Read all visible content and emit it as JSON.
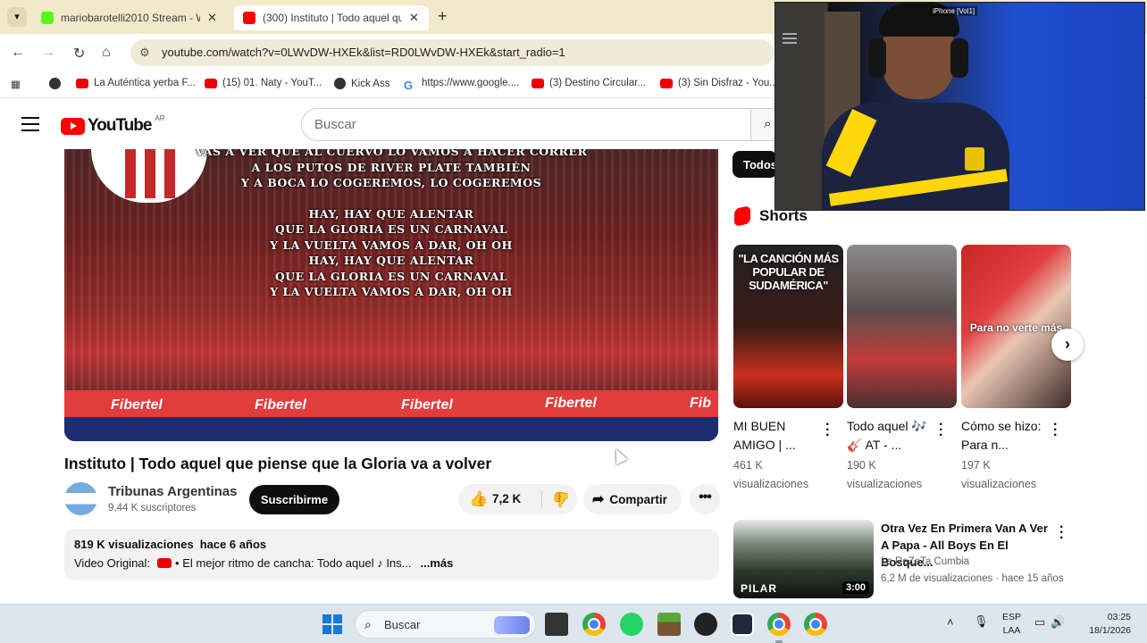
{
  "browser": {
    "tabs": [
      {
        "title": "mariobarotelli2010 Stream - W",
        "favicon": "kick-icon",
        "color": "#53fc18"
      },
      {
        "title": "(300) Instituto | Todo aquel que",
        "favicon": "youtube-icon",
        "color": "#ff0000",
        "active": true
      }
    ],
    "url": "youtube.com/watch?v=0LWvDW-HXEk&list=RD0LWvDW-HXEk&start_radio=1",
    "bookmarks": [
      {
        "label": "La Auténtica yerba F...",
        "icon": "youtube-icon"
      },
      {
        "label": "(15) 01. Naty - YouT...",
        "icon": "youtube-icon"
      },
      {
        "label": "Kick Ass",
        "icon": "globe-icon"
      },
      {
        "label": "https://www.google....",
        "icon": "google-icon"
      },
      {
        "label": "(3) Destino Circular...",
        "icon": "youtube-icon"
      },
      {
        "label": "(3) Sin Disfraz - You...",
        "icon": "youtube-icon"
      }
    ]
  },
  "youtube": {
    "logo_text": "YouTube",
    "country_code": "AR",
    "search_placeholder": "Buscar",
    "video": {
      "lyrics": [
        "VAS A VER QUE AL CUERVO LO VAMOS A HACER CORRER",
        "A LOS PUTOS DE RIVER PLATE TAMBIÉN",
        "Y A BOCA LO COGEREMOS, LO COGEREMOS",
        "",
        "HAY, HAY QUE ALENTAR",
        "QUE LA GLORIA ES UN CARNAVAL",
        "Y LA VUELTA VAMOS A DAR, OH OH",
        "HAY, HAY QUE ALENTAR",
        "QUE LA GLORIA ES UN CARNAVAL",
        "Y LA VUELTA VAMOS A DAR, OH OH"
      ],
      "ad_boards": [
        "Fibertel",
        "Fibertel",
        "Fibertel",
        "Fibertel",
        "Fib"
      ],
      "title": "Instituto | Todo aquel que piense que la Gloria va a volver",
      "channel_name": "Tribunas Argentinas",
      "channel_subs": "9,44 K suscriptores",
      "subscribe_label": "Suscribirme",
      "like_count": "7,2 K",
      "share_label": "Compartir",
      "more_label": "•••",
      "views": "819 K visualizaciones",
      "age": "hace 6 años",
      "desc_prefix": "Video Original:",
      "desc_link": "• El mejor ritmo de cancha: Todo aquel ♪ Ins...",
      "desc_more": "...más"
    },
    "sidebar": {
      "chip_all": "Todos",
      "shorts_heading": "Shorts",
      "shorts": [
        {
          "overlay": "\"LA CANCIÓN MÁS POPULAR DE SUDAMÉRICA\"",
          "title": "MI BUEN AMIGO | ...",
          "views": "461 K visualizaciones"
        },
        {
          "overlay": "",
          "title": "Todo aquel 🎶 🎸 AT - ...",
          "views": "190 K visualizaciones"
        },
        {
          "overlay": "Para no verte más",
          "title": "Cómo se hizo: Para n...",
          "views": "197 K visualizaciones"
        }
      ],
      "next_arrow": "›",
      "recommended": {
        "title": "Otra Vez En Primera Van A Ver A Papa - All Boys En El Bosque...",
        "channel": "La ReZeTa Cumbia",
        "meta": "6,2 M de visualizaciones · hace 15 años",
        "duration": "3:00",
        "thumb_text": "PILAR"
      }
    }
  },
  "webcam": {
    "label": "iPhone [Vol1]"
  },
  "taskbar": {
    "search_label": "Buscar",
    "lang_top": "ESP",
    "lang_bottom": "LAA",
    "time": "03:25",
    "date": "18/1/2026"
  }
}
